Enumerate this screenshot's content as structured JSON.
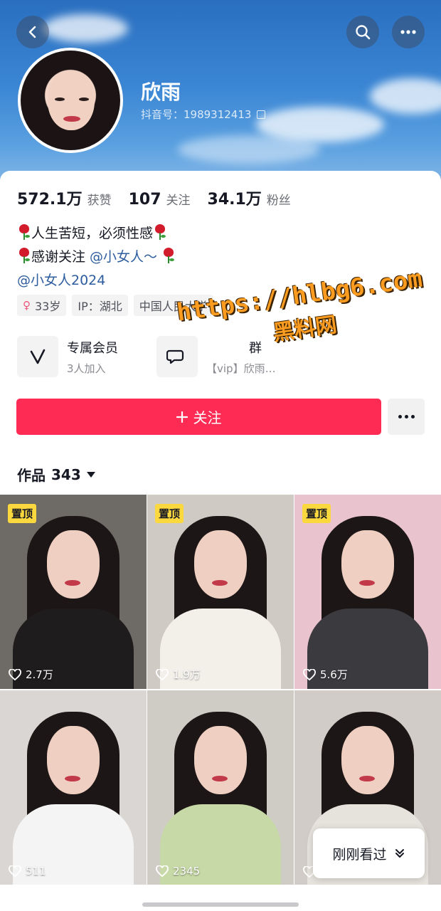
{
  "header": {
    "name": "欣雨",
    "douyin_id": "抖音号：1989312413"
  },
  "stats": [
    {
      "value": "572.1万",
      "label": "获赞"
    },
    {
      "value": "107",
      "label": "关注"
    },
    {
      "value": "34.1万",
      "label": "粉丝"
    }
  ],
  "bio": {
    "line1": "人生苦短，必须性感",
    "line2_text": "感谢关注 ",
    "line2_mention": "@小女人～",
    "line3_mention": "@小女人2024"
  },
  "tags": {
    "age": "33岁",
    "ip": "IP：湖北",
    "school": "中国人民大学"
  },
  "entries": [
    {
      "title": "专属会员",
      "sub": "3人加入"
    },
    {
      "title": "群",
      "sub": "【vip】欣雨…"
    }
  ],
  "actions": {
    "follow_label": "关注"
  },
  "works": {
    "label": "作品",
    "count": "343"
  },
  "grid": [
    {
      "pinned": true,
      "pin_label": "置顶",
      "likes": "2.7万",
      "bg": "#6e6a66",
      "body": "#1e1c1c"
    },
    {
      "pinned": true,
      "pin_label": "置顶",
      "likes": "1.9万",
      "bg": "#cfcac4",
      "body": "#f3f0ea"
    },
    {
      "pinned": true,
      "pin_label": "置顶",
      "likes": "5.6万",
      "bg": "#e9c4cf",
      "body": "#3a3a3f"
    },
    {
      "pinned": false,
      "pin_label": "",
      "likes": "511",
      "bg": "#d9d6d3",
      "body": "#f4f4f4"
    },
    {
      "pinned": false,
      "pin_label": "",
      "likes": "2345",
      "bg": "#cfcbc5",
      "body": "#c7d9a6"
    },
    {
      "pinned": false,
      "pin_label": "",
      "likes": "",
      "bg": "#d1ccc7",
      "body": "#e6e2dc"
    }
  ],
  "recent_label": "刚刚看过",
  "watermark": {
    "url": "https://hlbg6.com",
    "name": "黑料网"
  },
  "colors": {
    "follow": "#fe2c55",
    "mention": "#2e5d9f",
    "pin": "#fcd83f"
  }
}
